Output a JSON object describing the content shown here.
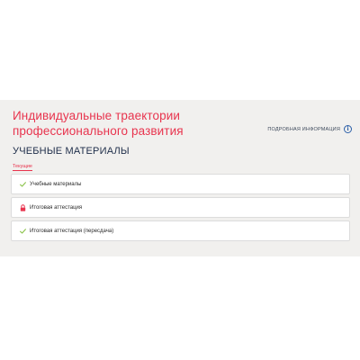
{
  "course": {
    "title_line1": "Индивидуальные траектории",
    "title_line2": "профессионального развития"
  },
  "more_info": {
    "label": "ПОДРОБНАЯ ИНФОРМАЦИЯ",
    "icon": "info-circle-icon",
    "icon_glyph": "i"
  },
  "section": {
    "heading": "УЧЕБНЫЕ МАТЕРИАЛЫ",
    "filter_tag": "Текущие"
  },
  "items": [
    {
      "label": "Учебные материалы",
      "icon": "checkmark-icon",
      "state": "completed"
    },
    {
      "label": "Итоговая аттестация",
      "icon": "lock-icon",
      "state": "locked"
    },
    {
      "label": "Итоговая аттестация (пересдача)",
      "icon": "checkmark-icon",
      "state": "completed"
    }
  ],
  "colors": {
    "accent": "#e8344e",
    "heading": "#1f2e4a",
    "check": "#8bc34a",
    "lock": "#e8344e",
    "panel_bg": "#f1f0ee",
    "info_icon": "#2b5fa8"
  }
}
